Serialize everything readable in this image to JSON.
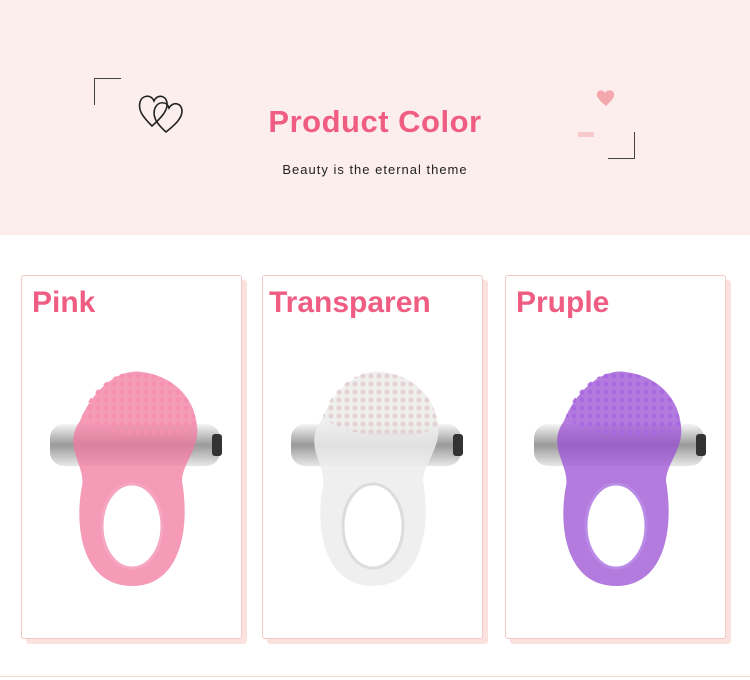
{
  "header": {
    "title": "Product Color",
    "subtitle": "Beauty is the eternal theme"
  },
  "products": [
    {
      "label": "Pink",
      "color": "#f27aa0"
    },
    {
      "label": "Transparen",
      "color": "#ececec"
    },
    {
      "label": "Pruple",
      "color": "#9a4fd3"
    }
  ],
  "colors": {
    "accent": "#ef5d82",
    "banner_background": "#fbeeec",
    "card_border": "#f2c9c4"
  }
}
